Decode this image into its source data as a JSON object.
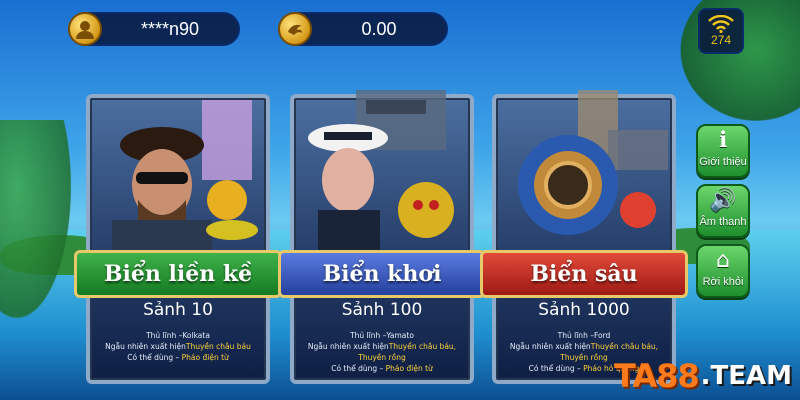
{
  "topbar": {
    "username": "****n90",
    "balance": "0.00",
    "signal_count": "274"
  },
  "side_menu": {
    "info_label": "Giới thiệu",
    "sound_label": "Âm thanh",
    "exit_label": "Rời khỏi"
  },
  "rooms": [
    {
      "name": "Biển liền kề",
      "lobby": "Sảnh 10",
      "boss_line": "Thủ lĩnh –Kolkata",
      "random_prefix": "Ngẫu nhiên xuất hiện",
      "random_highlight": "Thuyền châu báu",
      "usable_prefix": "Có thể dùng – ",
      "usable_highlight": "Pháo điện từ",
      "color": "#1f8e2c"
    },
    {
      "name": "Biển khơi",
      "lobby": "Sảnh 100",
      "boss_line": "Thủ lĩnh –Yamato",
      "random_prefix": "Ngẫu nhiên xuất hiện",
      "random_highlight": "Thuyền châu báu,",
      "random_highlight_2": "Thuyền rồng",
      "usable_prefix": "Có thể dùng – ",
      "usable_highlight": "Pháo điện từ",
      "color": "#2a47a8"
    },
    {
      "name": "Biển sâu",
      "lobby": "Sảnh 1000",
      "boss_line": "Thủ lĩnh –Ford",
      "random_prefix": "Ngẫu nhiên xuất hiện",
      "random_highlight": "Thuyền châu báu,",
      "random_highlight_2": "Thuyền rồng",
      "usable_prefix": "Có thể dùng – ",
      "usable_highlight": "Pháo hỏ quang",
      "color": "#b8221a"
    }
  ],
  "watermark": {
    "brand": "TA88",
    "suffix": ".TEAM"
  }
}
